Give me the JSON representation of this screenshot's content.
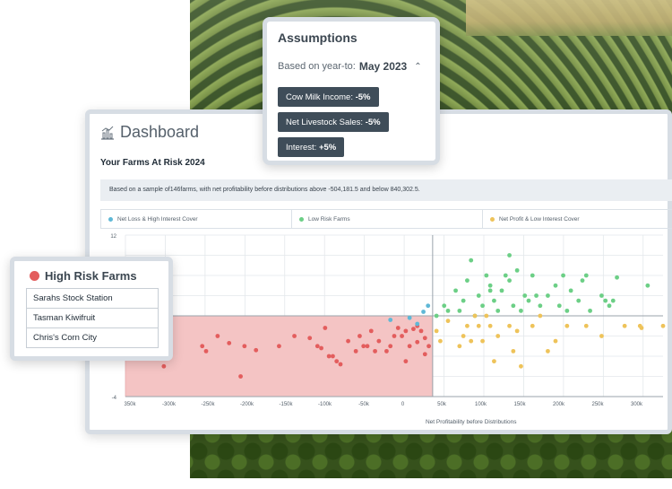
{
  "colors": {
    "loss_high_interest": "#5fb8d6",
    "low_risk": "#6ccf86",
    "profit_low_interest": "#eec35a",
    "high_risk": "#e35d5d",
    "high_risk_fill": "#f4c4c4",
    "pill_bg": "#3f4d59"
  },
  "assumptions": {
    "title": "Assumptions",
    "basis_prefix": "Based on year-to:",
    "basis_value": "May 2023",
    "chevron_icon": "chevron-up-icon",
    "items": [
      {
        "label": "Cow Milk Income:",
        "value": "-5%"
      },
      {
        "label": "Net Livestock Sales:",
        "value": "-5%"
      },
      {
        "label": "Interest:",
        "value": "+5%"
      }
    ]
  },
  "dashboard": {
    "icon": "bar-chart-icon",
    "title": "Dashboard",
    "subtitle": "Your Farms At Risk 2024",
    "sample_text": "Based on a sample of146farms, with net profitability before distributions above -504,181.5 and below 840,302.5.",
    "legend": [
      {
        "label": "Net Loss & High Interest Cover",
        "color": "#5fb8d6"
      },
      {
        "label": "Low Risk Farms",
        "color": "#6ccf86"
      },
      {
        "label": "Net Profit & Low Interest Cover",
        "color": "#eec35a"
      }
    ]
  },
  "high_risk": {
    "title": "High Risk Farms",
    "farms": [
      "Sarahs Stock Station",
      "Tasman Kiwifruit",
      "Chris's Corn City"
    ]
  },
  "chart_data": {
    "type": "scatter",
    "xlabel": "Net Profitability before Distributions",
    "ylabel": "",
    "xlim": [
      -350000,
      350000
    ],
    "ylim": [
      -4,
      12
    ],
    "x_ticks": [
      "350k",
      "-300k",
      "-250k",
      "-200k",
      "-150k",
      "-100k",
      "-50k",
      "0",
      "50k",
      "100k",
      "150k",
      "200k",
      "250k",
      "300k"
    ],
    "y_ticks": [
      "12",
      "-4"
    ],
    "high_risk_region": {
      "x": [
        -350000,
        50000
      ],
      "y": [
        -4,
        4
      ]
    },
    "series": [
      {
        "color": "#e35d5d",
        "points": [
          [
            -300000,
            -1
          ],
          [
            -250000,
            1
          ],
          [
            -245000,
            0.5
          ],
          [
            -230000,
            2
          ],
          [
            -215000,
            1.3
          ],
          [
            -200000,
            -2
          ],
          [
            -195000,
            1
          ],
          [
            -180000,
            0.6
          ],
          [
            -150000,
            1
          ],
          [
            -130000,
            2
          ],
          [
            -110000,
            1.8
          ],
          [
            -100000,
            1
          ],
          [
            -95000,
            0.8
          ],
          [
            -90000,
            2.8
          ],
          [
            -85000,
            0
          ],
          [
            -80000,
            0
          ],
          [
            -75000,
            -0.5
          ],
          [
            -70000,
            -0.8
          ],
          [
            -60000,
            1.5
          ],
          [
            -50000,
            0.5
          ],
          [
            -45000,
            2
          ],
          [
            -40000,
            1
          ],
          [
            -35000,
            1
          ],
          [
            -30000,
            2.5
          ],
          [
            -25000,
            0.5
          ],
          [
            -20000,
            1.5
          ],
          [
            -10000,
            0.5
          ],
          [
            -5000,
            1
          ],
          [
            0,
            2
          ],
          [
            5000,
            2.8
          ],
          [
            10000,
            2
          ],
          [
            15000,
            2.5
          ],
          [
            20000,
            1
          ],
          [
            25000,
            2.7
          ],
          [
            30000,
            1.4
          ],
          [
            35000,
            2.5
          ],
          [
            40000,
            1.8
          ],
          [
            45000,
            1
          ],
          [
            40000,
            0.2
          ],
          [
            15000,
            -0.5
          ],
          [
            30000,
            3
          ]
        ]
      },
      {
        "color": "#5fb8d6",
        "points": [
          [
            -5000,
            3.6
          ],
          [
            20000,
            3.8
          ],
          [
            30000,
            3.2
          ],
          [
            38000,
            4.4
          ],
          [
            44000,
            5
          ]
        ]
      },
      {
        "color": "#6ccf86",
        "points": [
          [
            55000,
            4
          ],
          [
            65000,
            5
          ],
          [
            70000,
            4.5
          ],
          [
            80000,
            6.5
          ],
          [
            85000,
            4.5
          ],
          [
            90000,
            5.5
          ],
          [
            95000,
            7.5
          ],
          [
            100000,
            9.5
          ],
          [
            105000,
            4
          ],
          [
            110000,
            6
          ],
          [
            115000,
            5
          ],
          [
            120000,
            8
          ],
          [
            125000,
            7
          ],
          [
            130000,
            5.5
          ],
          [
            135000,
            4.5
          ],
          [
            140000,
            6.5
          ],
          [
            145000,
            8
          ],
          [
            150000,
            7.5
          ],
          [
            150000,
            10
          ],
          [
            155000,
            5
          ],
          [
            160000,
            8.5
          ],
          [
            165000,
            4.5
          ],
          [
            170000,
            6
          ],
          [
            175000,
            5.5
          ],
          [
            180000,
            8
          ],
          [
            185000,
            6
          ],
          [
            190000,
            5
          ],
          [
            200000,
            6
          ],
          [
            210000,
            7
          ],
          [
            215000,
            5
          ],
          [
            220000,
            8
          ],
          [
            225000,
            4.5
          ],
          [
            230000,
            6.5
          ],
          [
            240000,
            5.5
          ],
          [
            245000,
            7.5
          ],
          [
            250000,
            8
          ],
          [
            255000,
            4.5
          ],
          [
            270000,
            6
          ],
          [
            275000,
            5.5
          ],
          [
            280000,
            5
          ],
          [
            285000,
            5.5
          ],
          [
            290000,
            7.8
          ],
          [
            330000,
            7
          ],
          [
            125000,
            6.5
          ]
        ]
      },
      {
        "color": "#eec35a",
        "points": [
          [
            55000,
            2.5
          ],
          [
            60000,
            1.5
          ],
          [
            70000,
            3.5
          ],
          [
            85000,
            1
          ],
          [
            90000,
            2
          ],
          [
            95000,
            3
          ],
          [
            100000,
            1.5
          ],
          [
            105000,
            4
          ],
          [
            110000,
            3
          ],
          [
            115000,
            1.5
          ],
          [
            120000,
            4
          ],
          [
            125000,
            3
          ],
          [
            130000,
            -0.5
          ],
          [
            135000,
            2
          ],
          [
            150000,
            3
          ],
          [
            155000,
            0.5
          ],
          [
            160000,
            2.5
          ],
          [
            165000,
            -1
          ],
          [
            180000,
            3
          ],
          [
            190000,
            4
          ],
          [
            200000,
            0.5
          ],
          [
            210000,
            1.5
          ],
          [
            225000,
            3
          ],
          [
            250000,
            3
          ],
          [
            270000,
            2
          ],
          [
            300000,
            3
          ],
          [
            320000,
            3
          ],
          [
            322000,
            2.8
          ],
          [
            350000,
            3
          ]
        ]
      }
    ]
  }
}
